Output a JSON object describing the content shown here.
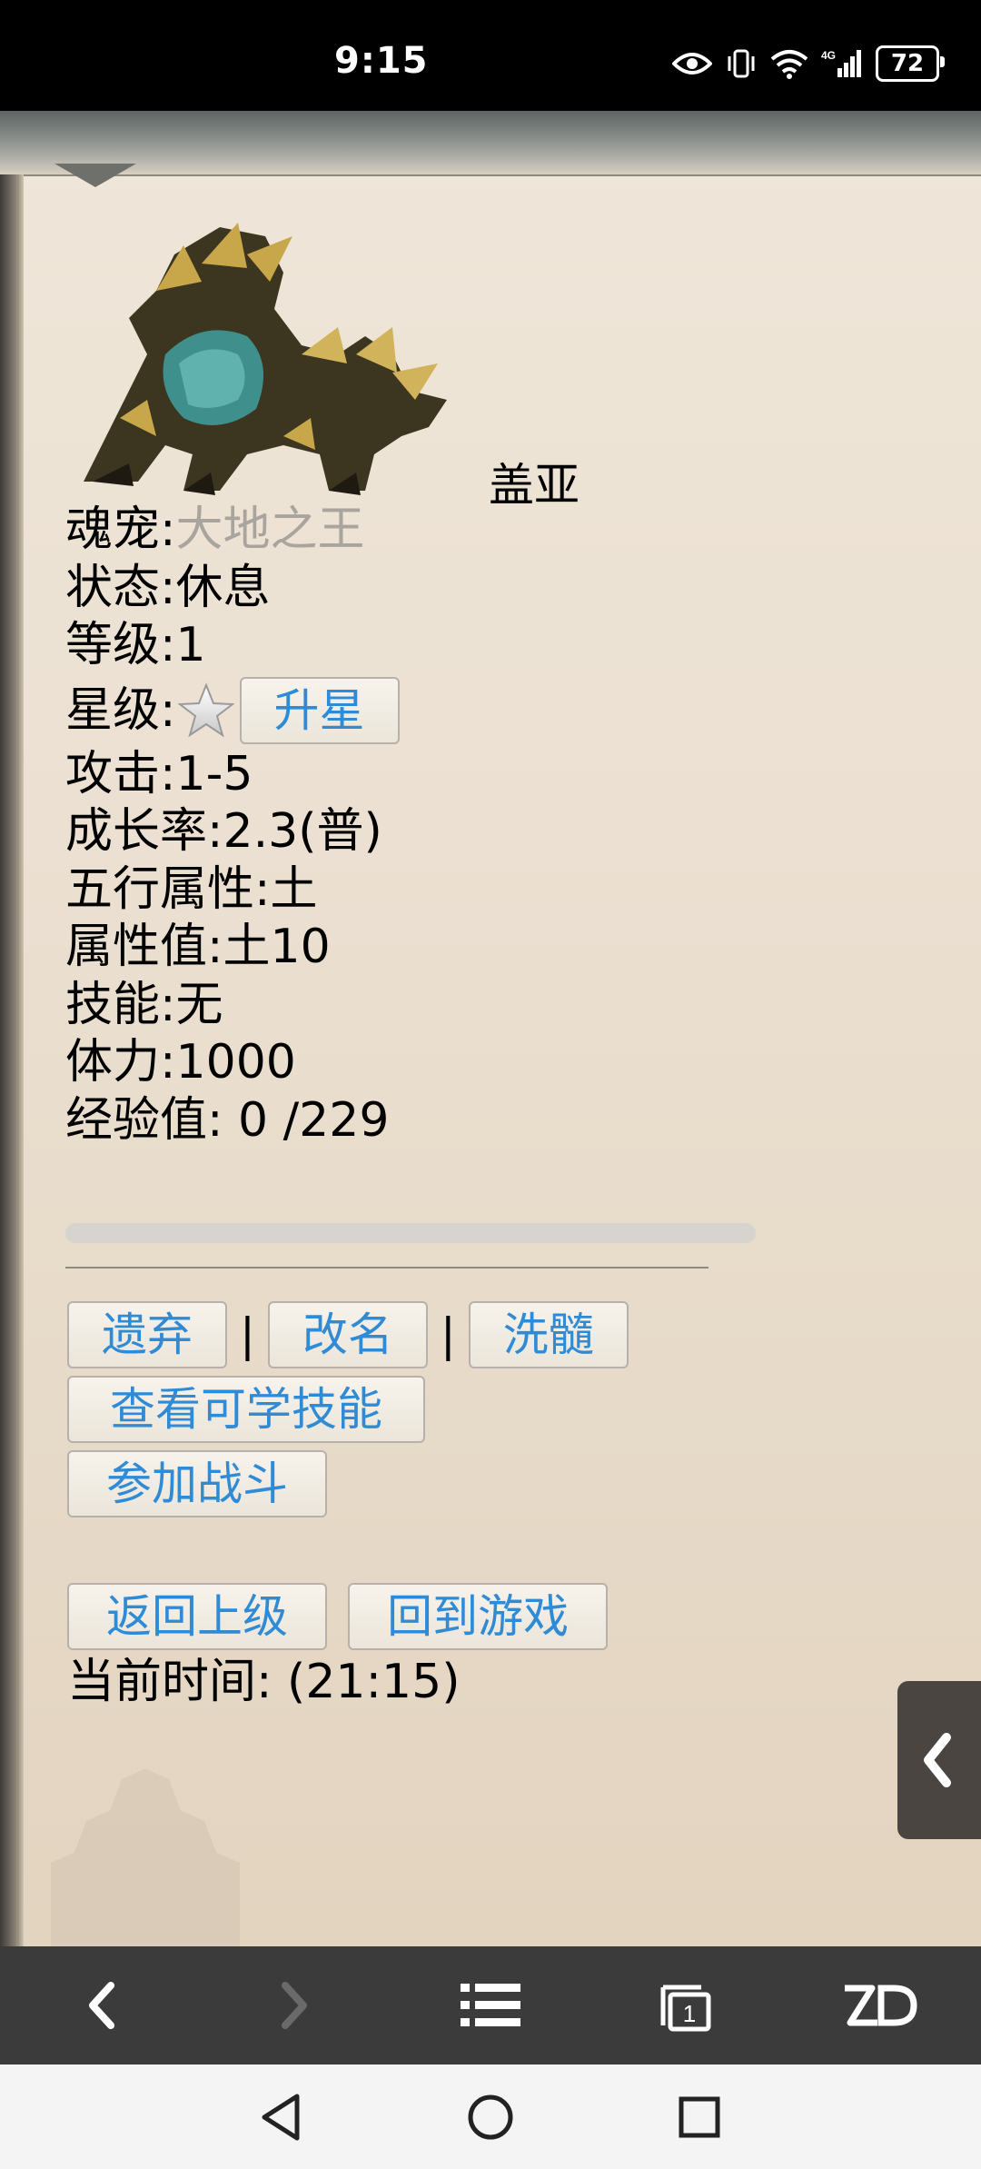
{
  "status": {
    "time": "9:15",
    "battery": "72",
    "network": "4G"
  },
  "pet": {
    "name": "盖亚",
    "soul_label": "魂宠:",
    "soul_value": "大地之王",
    "state": "状态:休息",
    "level": "等级:1",
    "star_label": "星级:",
    "star_up_button": "升星",
    "attack": "攻击:1-5",
    "growth": "成长率:2.3(普)",
    "element": "五行属性:土",
    "element_value": "属性值:土10",
    "skill": "技能:无",
    "stamina": "体力:1000",
    "exp": "经验值: 0 /229",
    "exp_progress_percent": 0
  },
  "actions": {
    "abandon": "遗弃",
    "rename": "改名",
    "reset": "洗髓",
    "separator": "|",
    "view_skills": "查看可学技能",
    "join_battle": "参加战斗",
    "back": "返回上级",
    "return_game": "回到游戏"
  },
  "current_time": "当前时间: (21:15)",
  "colors": {
    "link_blue": "#2f8bd6",
    "gray_text": "#a9a49d",
    "toolbar": "#3b3b3b"
  }
}
